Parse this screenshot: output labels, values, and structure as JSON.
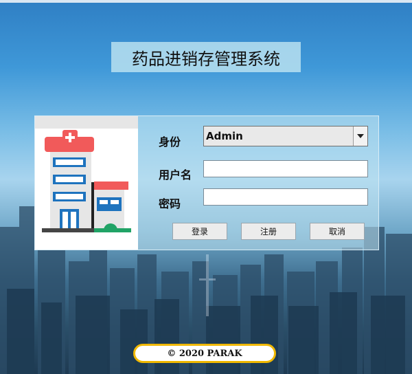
{
  "app": {
    "title": "药品进销存管理系统"
  },
  "form": {
    "identity_label": "身份",
    "identity_value": "Admin",
    "username_label": "用户名",
    "username_value": "",
    "password_label": "密码",
    "password_value": ""
  },
  "buttons": {
    "login": "登录",
    "register": "注册",
    "cancel": "取消"
  },
  "footer": {
    "copyright": "©  2020  PARAK"
  },
  "colors": {
    "logo_red": "#f15a5a",
    "logo_blue": "#1e73be",
    "logo_green": "#21a366",
    "footer_border": "#f0b800"
  },
  "icons": {
    "logo": "hospital-icon",
    "dropdown": "chevron-down-icon"
  }
}
